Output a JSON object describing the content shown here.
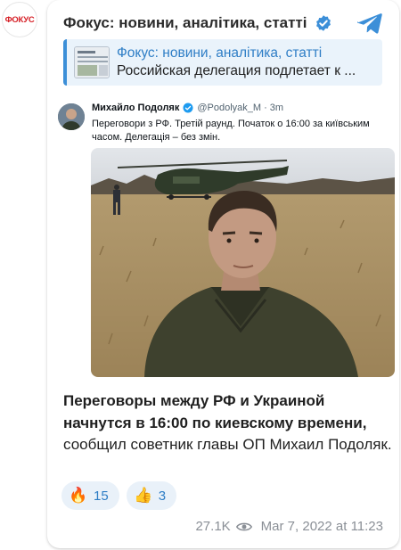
{
  "channel": {
    "avatar_text": "ФОКУС",
    "name": "Фокус: новини, аналітика, статті",
    "brand_color": "#d62027",
    "verified": true
  },
  "reply": {
    "title": "Фокус: новини, аналітика, статті",
    "text": "Российская делегация подлетает к ..."
  },
  "tweet": {
    "name": "Михайло Подоляк",
    "handle": "@Podolyak_M",
    "time": "· 3m",
    "text": "Переговори з РФ. Третій раунд. Початок о 16:00 за київським часом. Делегація – без змін."
  },
  "message": {
    "bold_text": "Переговоры между РФ и Украиной начнутся в 16:00 по киевскому времени,",
    "rest_text": " сообщил советник главы ОП Михаил Подоляк."
  },
  "reactions": [
    {
      "icon": "fire-icon",
      "emoji": "🔥",
      "count": "15"
    },
    {
      "icon": "thumbs-up-icon",
      "emoji": "👍",
      "count": "3"
    }
  ],
  "meta": {
    "views": "27.1K",
    "timestamp": "Mar 7, 2022 at 11:23"
  },
  "colors": {
    "accent": "#2f7ec6",
    "reply_bg": "#eaf3fb",
    "reaction_bg": "#e9f1f9"
  }
}
